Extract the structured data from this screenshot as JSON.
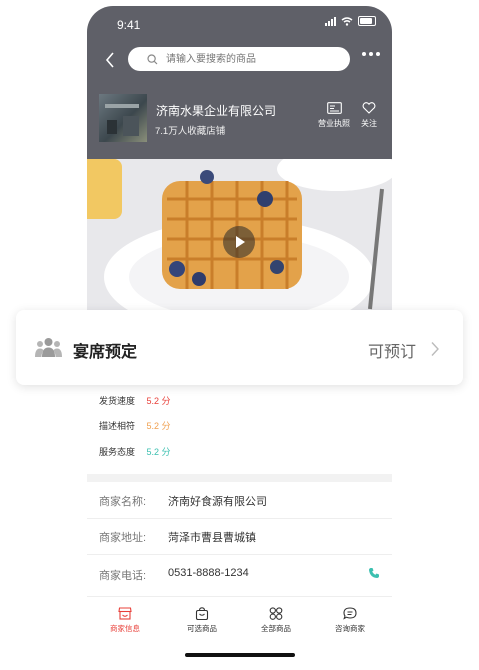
{
  "status": {
    "time": "9:41"
  },
  "search": {
    "placeholder": "请输入要搜索的商品"
  },
  "shop": {
    "name": "济南水果企业有限公司",
    "favorites": "7.1万人收藏店铺",
    "license_label": "营业执照",
    "follow_label": "关注"
  },
  "booking_card": {
    "title": "宴席预定",
    "action": "可预订"
  },
  "ratings": [
    {
      "label": "发货速度",
      "value": "5.2 分",
      "color": "#e8403a"
    },
    {
      "label": "描述相符",
      "value": "5.2 分",
      "color": "#f0a050"
    },
    {
      "label": "服务态度",
      "value": "5.2 分",
      "color": "#3cc0b0"
    }
  ],
  "details": {
    "name_label": "商家名称:",
    "name_value": "济南好食源有限公司",
    "address_label": "商家地址:",
    "address_value": "菏泽市曹县曹城镇",
    "phone_label": "商家电话:",
    "phone_value": "0531-8888-1234"
  },
  "tabs": [
    {
      "label": "商家信息",
      "icon": "shop-icon",
      "active": true
    },
    {
      "label": "可选商品",
      "icon": "bag-icon",
      "active": false
    },
    {
      "label": "全部商品",
      "icon": "grid-icon",
      "active": false
    },
    {
      "label": "咨询商家",
      "icon": "chat-icon",
      "active": false
    }
  ],
  "colors": {
    "header_bg": "#5f6068",
    "accent": "#e8403a",
    "phone_icon": "#3cc0b0"
  }
}
